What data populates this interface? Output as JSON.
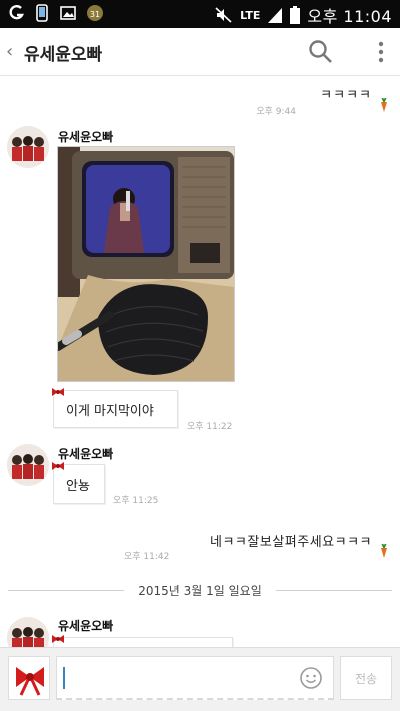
{
  "status_bar": {
    "network": "LTE",
    "time": "오후 11:04",
    "badge": "31"
  },
  "header": {
    "title": "유세윤오빠"
  },
  "messages": {
    "m1": {
      "text": "ㅋㅋㅋㅋ",
      "time": "오후 9:44"
    },
    "m2": {
      "sender": "유세윤오빠",
      "text": "이게 마지막이야",
      "time": "오후 11:22"
    },
    "m3": {
      "sender": "유세윤오빠",
      "text": "안뇽",
      "time": "오후 11:25"
    },
    "m4": {
      "text": "네ㅋㅋ잘보살펴주세요ㅋㅋㅋ",
      "time": "오후 11:42"
    },
    "m5": {
      "sender": "유세윤오빠"
    }
  },
  "date_divider": "2015년 3월 1일 일요일",
  "input": {
    "send_label": "전송"
  },
  "colors": {
    "status_bar": "#0a0a0a",
    "caret": "#2f86c8",
    "ribbon": "#c81e1e",
    "carrot": "#e0701c"
  }
}
